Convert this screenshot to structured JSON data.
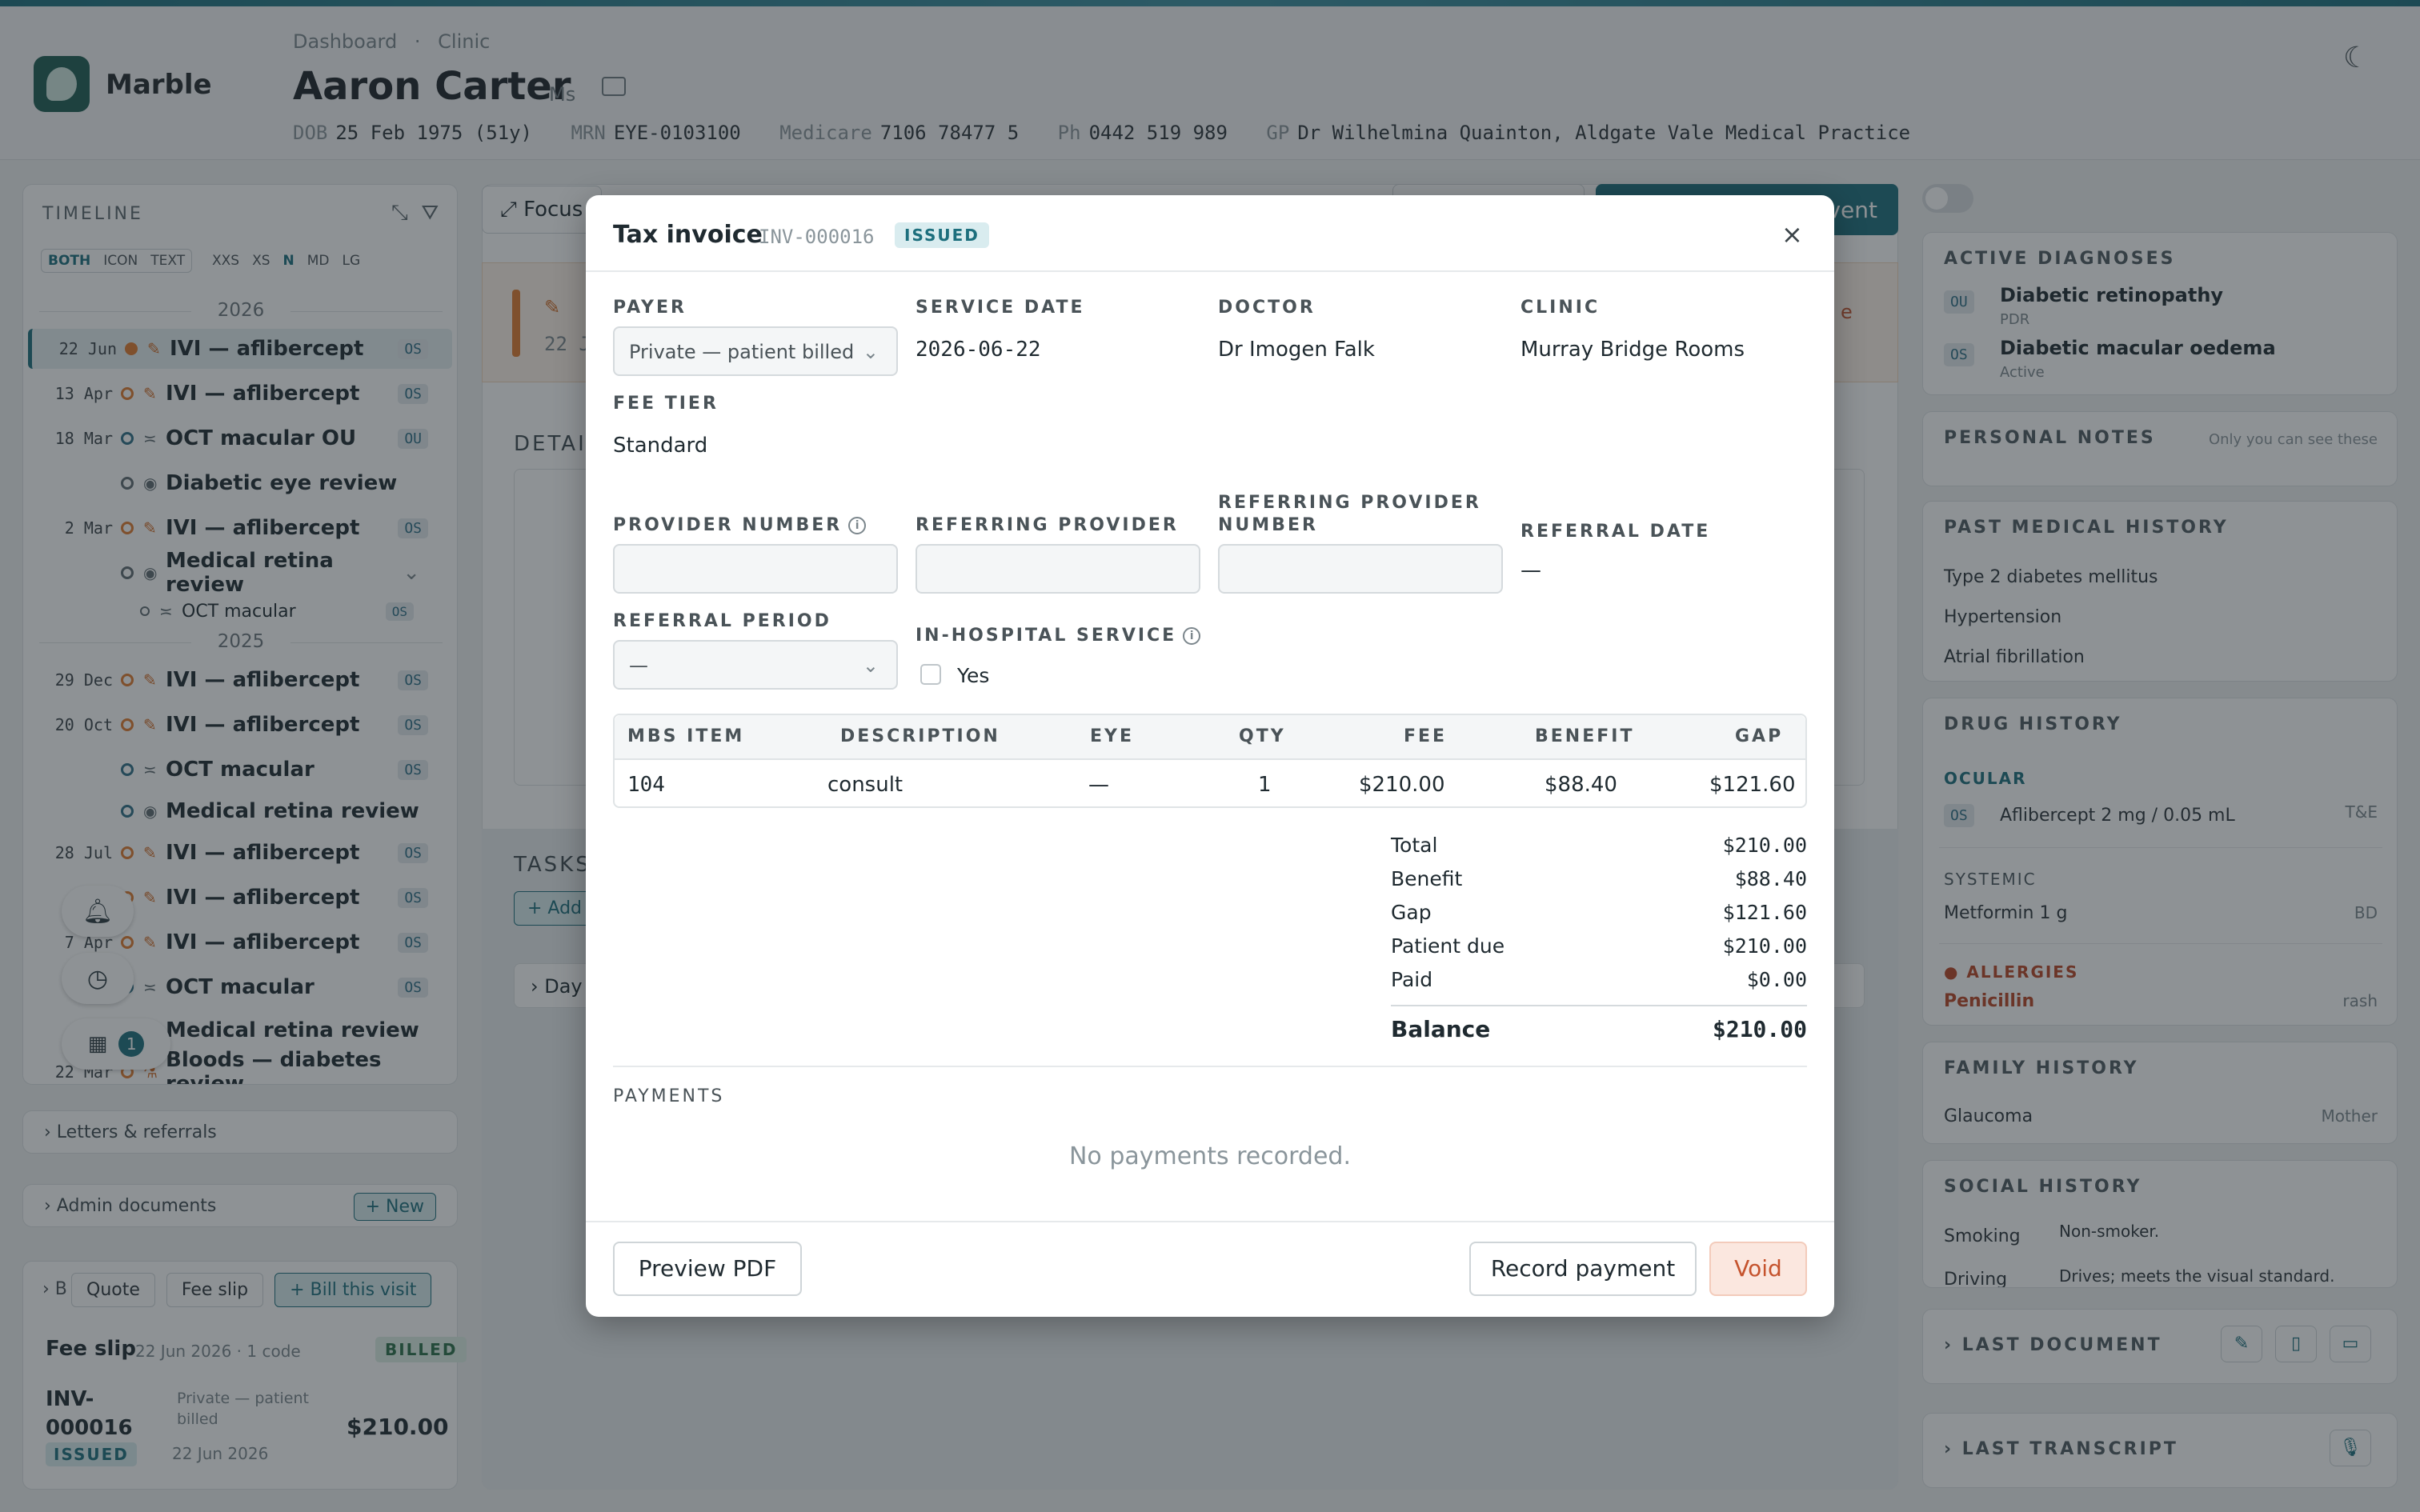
{
  "app": {
    "name": "Marble"
  },
  "breadcrumb": [
    "Dashboard",
    "Clinic"
  ],
  "patient": {
    "name": "Aaron Carter",
    "title": "Ms",
    "dob_label": "DOB",
    "dob": "25 Feb 1975 (51y)",
    "mrn_label": "MRN",
    "mrn": "EYE-0103100",
    "medicare_label": "Medicare",
    "medicare": "7106 78477 5",
    "phone_label": "Ph",
    "phone": "0442 519 989",
    "gp_label": "GP",
    "gp": "Dr Wilhelmina Quainton, Aldgate Vale Medical Practice"
  },
  "timeline": {
    "title": "TIMELINE",
    "modes": [
      "BOTH",
      "ICON",
      "TEXT"
    ],
    "sizes": [
      "XXS",
      "XS",
      "N",
      "MD",
      "LG"
    ],
    "years": [
      "2026",
      "2025"
    ],
    "items": [
      {
        "date": "22 Jun",
        "label": "IVI — aflibercept",
        "eye": "OS"
      },
      {
        "date": "13 Apr",
        "label": "IVI — aflibercept",
        "eye": "OS"
      },
      {
        "date": "18 Mar",
        "label": "OCT macular OU",
        "eye": "OU"
      },
      {
        "date": "",
        "label": "Diabetic eye review",
        "eye": ""
      },
      {
        "date": "2 Mar",
        "label": "IVI — aflibercept",
        "eye": "OS"
      },
      {
        "date": "",
        "label": "Medical retina review",
        "eye": ""
      },
      {
        "date": "",
        "label": "OCT macular",
        "eye": "OS"
      },
      {
        "date": "29 Dec",
        "label": "IVI — aflibercept",
        "eye": "OS"
      },
      {
        "date": "20 Oct",
        "label": "IVI — aflibercept",
        "eye": "OS"
      },
      {
        "date": "",
        "label": "OCT macular",
        "eye": "OS"
      },
      {
        "date": "",
        "label": "Medical retina review",
        "eye": ""
      },
      {
        "date": "28 Jul",
        "label": "IVI — aflibercept",
        "eye": "OS"
      },
      {
        "date": "",
        "label": "IVI — aflibercept",
        "eye": "OS"
      },
      {
        "date": "7 Apr",
        "label": "IVI — aflibercept",
        "eye": "OS"
      },
      {
        "date": "",
        "label": "OCT macular",
        "eye": "OS"
      },
      {
        "date": "",
        "label": "Medical retina review",
        "eye": ""
      },
      {
        "date": "22 Mar",
        "label": "Bloods — diabetes review",
        "eye": ""
      }
    ],
    "calendar_badge": "1"
  },
  "left_sections": {
    "letters": "Letters & referrals",
    "admin": "Admin documents",
    "admin_new": "+ New",
    "billing_tabs": [
      "Quote",
      "Fee slip",
      "+ Bill this visit"
    ],
    "billing_lead": "B"
  },
  "fee_slip": {
    "title": "Fee slip",
    "sub": "22 Jun 2026 · 1 code",
    "status": "BILLED",
    "invoice": "INV-000016",
    "payer": "Private — patient billed",
    "amount": "$210.00",
    "invoice_status": "ISSUED",
    "date": "22 Jun 2026"
  },
  "center": {
    "focus": "Focus",
    "new_event_suffix": "vent",
    "details": "DETAI",
    "tasks": "TASKS",
    "add": "+ Add",
    "day": "Day",
    "event_date": "22 J",
    "event_tag": "e"
  },
  "right": {
    "active_diagnoses": "ACTIVE DIAGNOSES",
    "diagnoses": [
      {
        "eye": "OU",
        "name": "Diabetic retinopathy",
        "meta": "PDR"
      },
      {
        "eye": "OS",
        "name": "Diabetic macular oedema",
        "meta": "Active"
      }
    ],
    "personal_notes": "PERSONAL NOTES",
    "personal_notes_hint": "Only you can see these",
    "pmh_title": "PAST MEDICAL HISTORY",
    "pmh": [
      "Type 2 diabetes mellitus",
      "Hypertension",
      "Atrial fibrillation"
    ],
    "drug_title": "DRUG HISTORY",
    "ocular": "OCULAR",
    "ocular_drug": {
      "eye": "OS",
      "name": "Aflibercept 2 mg / 0.05 mL",
      "freq": "T&E"
    },
    "systemic": "SYSTEMIC",
    "systemic_drug": {
      "name": "Metformin 1 g",
      "freq": "BD"
    },
    "allergies": "ALLERGIES",
    "allergy": {
      "name": "Penicillin",
      "reaction": "rash"
    },
    "family_title": "FAMILY HISTORY",
    "family": {
      "condition": "Glaucoma",
      "relation": "Mother"
    },
    "social_title": "SOCIAL HISTORY",
    "social": [
      {
        "k": "Smoking",
        "v": "Non-smoker."
      },
      {
        "k": "Driving",
        "v": "Drives; meets the visual standard."
      }
    ],
    "last_document": "LAST DOCUMENT",
    "last_transcript": "LAST TRANSCRIPT"
  },
  "modal": {
    "title": "Tax invoice",
    "invoice_no": "INV-000016",
    "status": "ISSUED",
    "payer_label": "PAYER",
    "payer": "Private — patient billed",
    "service_date_label": "SERVICE DATE",
    "service_date": "2026-06-22",
    "doctor_label": "DOCTOR",
    "doctor": "Dr Imogen Falk",
    "clinic_label": "CLINIC",
    "clinic": "Murray Bridge Rooms",
    "fee_tier_label": "FEE TIER",
    "fee_tier": "Standard",
    "provider_number_label": "PROVIDER NUMBER",
    "referring_provider_label": "REFERRING PROVIDER",
    "referring_provider_number_label_1": "REFERRING PROVIDER",
    "referring_provider_number_label_2": "NUMBER",
    "referral_date_label": "REFERRAL DATE",
    "referral_date": "—",
    "referral_period_label": "REFERRAL PERIOD",
    "referral_period": "—",
    "in_hospital_label": "IN-HOSPITAL SERVICE",
    "in_hospital_option": "Yes",
    "table_headers": [
      "MBS ITEM",
      "DESCRIPTION",
      "EYE",
      "QTY",
      "FEE",
      "BENEFIT",
      "GAP"
    ],
    "items": [
      {
        "mbs": "104",
        "description": "consult",
        "eye": "—",
        "qty": "1",
        "fee": "$210.00",
        "benefit": "$88.40",
        "gap": "$121.60"
      }
    ],
    "totals": [
      {
        "label": "Total",
        "value": "$210.00"
      },
      {
        "label": "Benefit",
        "value": "$88.40"
      },
      {
        "label": "Gap",
        "value": "$121.60"
      },
      {
        "label": "Patient due",
        "value": "$210.00"
      },
      {
        "label": "Paid",
        "value": "$0.00"
      }
    ],
    "balance_label": "Balance",
    "balance": "$210.00",
    "payments_label": "PAYMENTS",
    "no_payments": "No payments recorded.",
    "preview_pdf": "Preview PDF",
    "record_payment": "Record payment",
    "void": "Void"
  }
}
